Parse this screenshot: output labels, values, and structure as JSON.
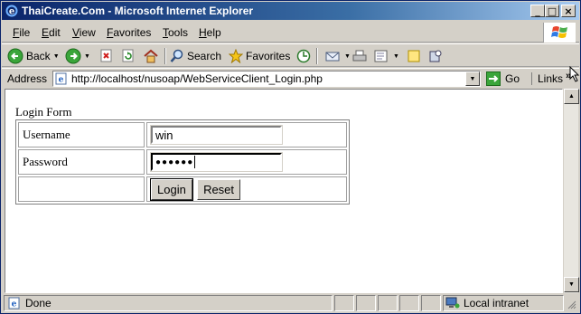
{
  "window": {
    "title": "ThaiCreate.Com - Microsoft Internet Explorer",
    "min_glyph": "_",
    "max_glyph": "□",
    "close_glyph": "×"
  },
  "menu": {
    "items": [
      {
        "u": "F",
        "rest": "ile"
      },
      {
        "u": "E",
        "rest": "dit"
      },
      {
        "u": "V",
        "rest": "iew"
      },
      {
        "u": "",
        "rest": "Favorites",
        "uidx": "F"
      },
      {
        "u": "T",
        "rest": "ools"
      },
      {
        "u": "H",
        "rest": "elp"
      }
    ]
  },
  "toolbar": {
    "back_label": "Back",
    "search_label": "Search",
    "favorites_label": "Favorites"
  },
  "address": {
    "label": "Address",
    "url": "http://localhost/nusoap/WebServiceClient_Login.php",
    "go_label": "Go",
    "links_label": "Links",
    "chevron": "»"
  },
  "page": {
    "form_title": "Login Form",
    "username_label": "Username",
    "username_value": "win",
    "password_label": "Password",
    "password_value": "●●●●●●",
    "login_button": "Login",
    "reset_button": "Reset"
  },
  "status": {
    "text": "Done",
    "zone": "Local intranet"
  },
  "colors": {
    "titlebar_start": "#0a246a",
    "titlebar_end": "#a6caf0",
    "chrome": "#d4d0c8"
  }
}
